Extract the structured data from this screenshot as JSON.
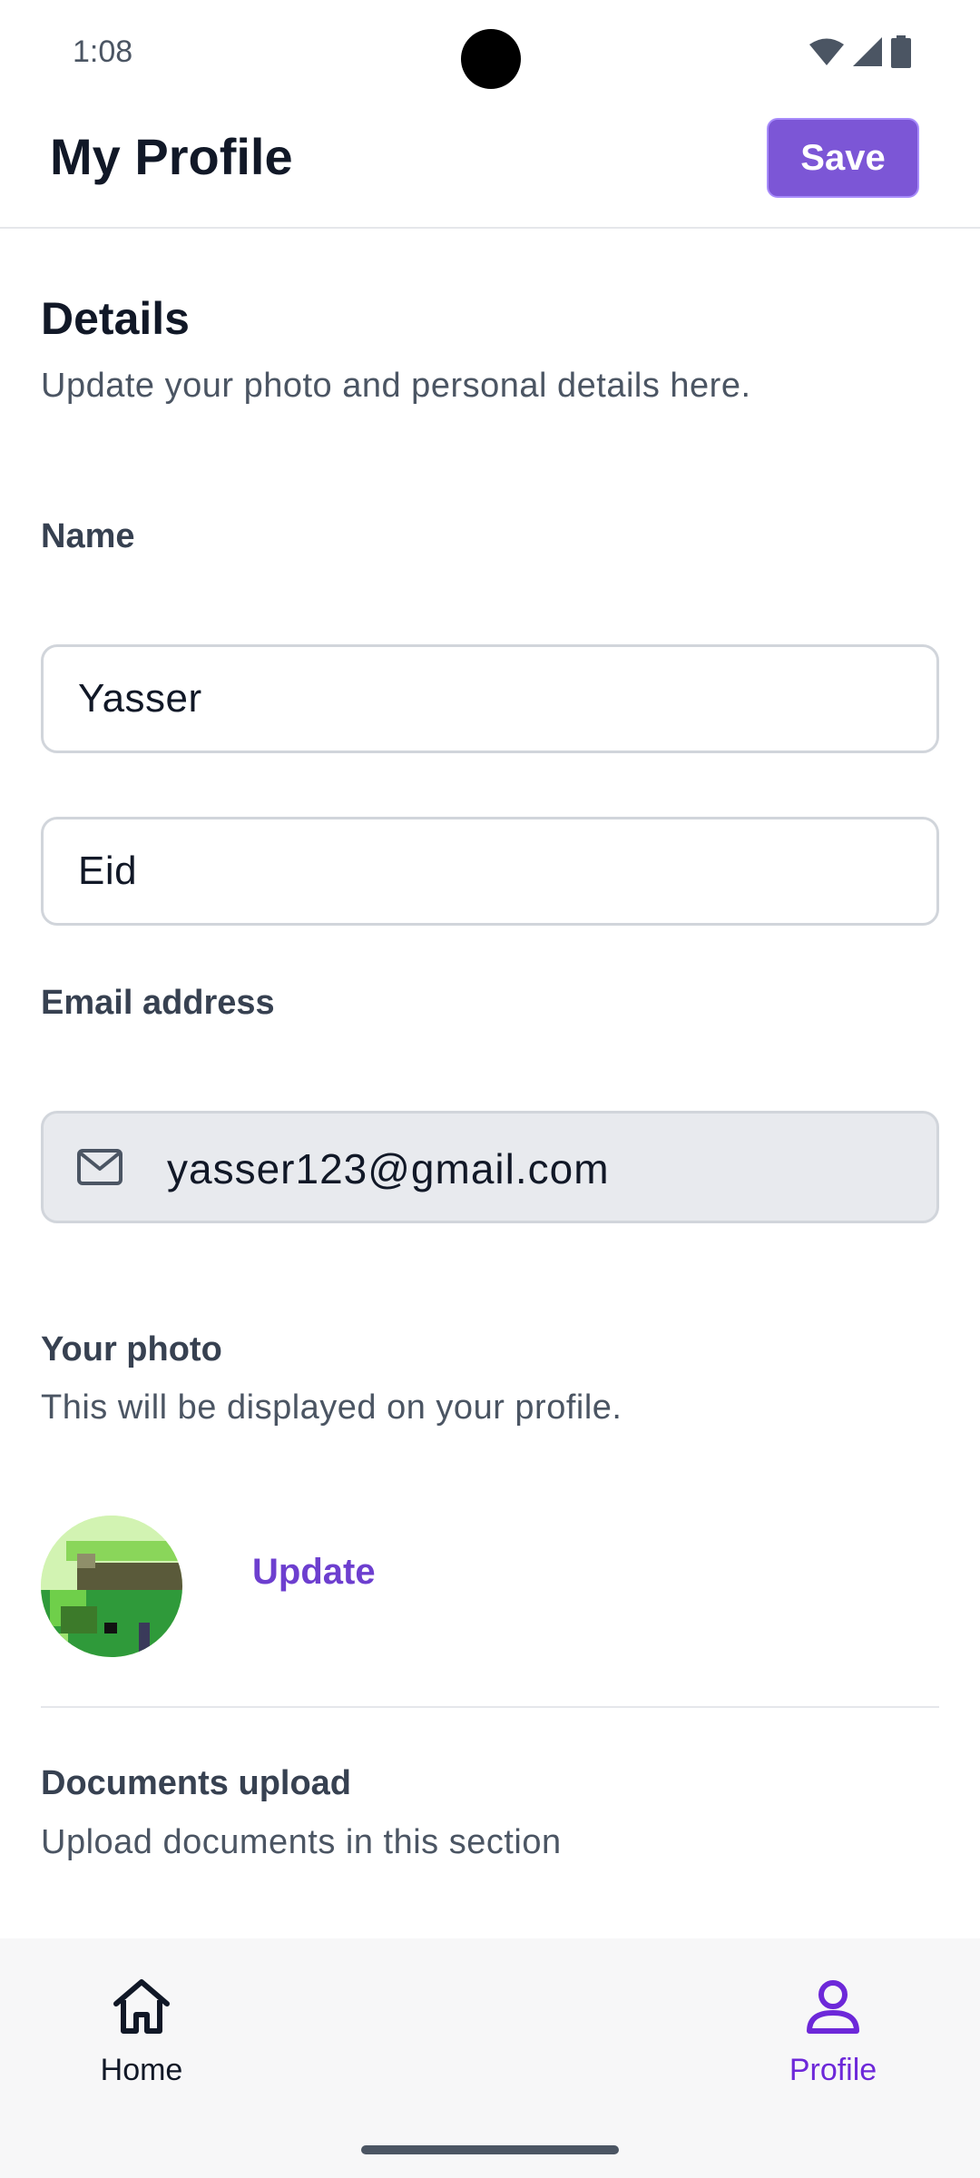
{
  "status_bar": {
    "time": "1:08",
    "icons": [
      "wifi-icon",
      "cellular-signal-icon",
      "battery-icon"
    ]
  },
  "header": {
    "title": "My Profile",
    "save_label": "Save"
  },
  "details": {
    "heading": "Details",
    "description": "Update your photo and personal details here."
  },
  "name": {
    "label": "Name",
    "first_name": "Yasser",
    "last_name": "Eid"
  },
  "email": {
    "label": "Email address",
    "value": "yasser123@gmail.com",
    "icon": "mail-icon"
  },
  "photo": {
    "label": "Your photo",
    "description": "This will be displayed on your profile.",
    "update_label": "Update"
  },
  "documents": {
    "label": "Documents upload",
    "description": "Upload documents in this section"
  },
  "bottom_nav": {
    "home_label": "Home",
    "profile_label": "Profile",
    "active": "Profile"
  },
  "colors": {
    "accent": "#7c56d6",
    "link": "#6d3fcf",
    "nav_active": "#6d28d9"
  }
}
